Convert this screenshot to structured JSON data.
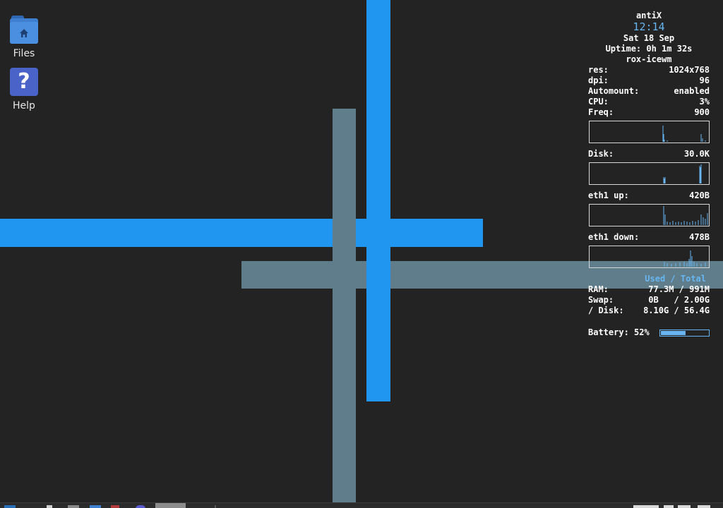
{
  "desktop_icons": {
    "files": {
      "label": "Files",
      "icon": "folder-home-icon"
    },
    "help": {
      "label": "Help",
      "icon": "help-icon",
      "glyph": "?"
    }
  },
  "conky": {
    "os": "antiX",
    "time": "12:14",
    "date": "Sat 18 Sep",
    "uptime": "Uptime: 0h 1m 32s",
    "session": "rox-icewm",
    "rows": [
      {
        "label": "res:",
        "value": "1024x768"
      },
      {
        "label": "dpi:",
        "value": "96"
      },
      {
        "label": "Automount:",
        "value": "enabled"
      },
      {
        "label": "CPU:",
        "value": "3%"
      },
      {
        "label": "Freq:",
        "value": "900"
      }
    ],
    "disk": {
      "label": "Disk:",
      "value": "30.0K"
    },
    "eth_up": {
      "label": "eth1 up:",
      "value": "420B"
    },
    "eth_down": {
      "label": "eth1 down:",
      "value": "478B"
    },
    "mem_header": "Used / Total",
    "ram": {
      "label": "RAM:",
      "value": "77.3M / 991M"
    },
    "swap": {
      "label": "Swap:",
      "value": "0B   / 2.00G"
    },
    "root_disk": {
      "label": "/ Disk:",
      "value": "8.10G / 56.4G"
    },
    "battery": {
      "label": "Battery: 52%",
      "percent": 52
    }
  },
  "colors": {
    "background": "#232323",
    "accent_blue": "#2196f0",
    "slate": "#607d8b",
    "conky_accent": "#67b6f2"
  }
}
